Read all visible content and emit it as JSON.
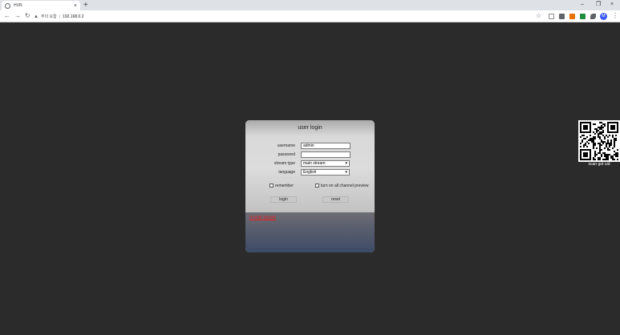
{
  "browser": {
    "tab_title": "HVR",
    "tab_close": "×",
    "new_tab": "+",
    "window_minimize": "–",
    "window_restore": "❐",
    "window_close": "×",
    "security_warning": "주의 요함",
    "url": "192.168.0.2",
    "avatar_letter": "M"
  },
  "login": {
    "title": "user login",
    "username_label": "username",
    "username_value": "admin",
    "password_label": "password",
    "password_value": "",
    "stream_type_label": "stream type",
    "stream_type_value": "main stream",
    "language_label": "language",
    "language_value": "English",
    "remember_label": "remember",
    "preview_label": "turn on all channel preview",
    "login_button": "login",
    "reset_button": "reset",
    "plugin_link": "Install plugin"
  },
  "qr": {
    "caption": "scan get uid"
  },
  "colors": {
    "page_background": "#2b2b2b",
    "link_red": "#e52020",
    "avatar_blue": "#3d5afe"
  }
}
